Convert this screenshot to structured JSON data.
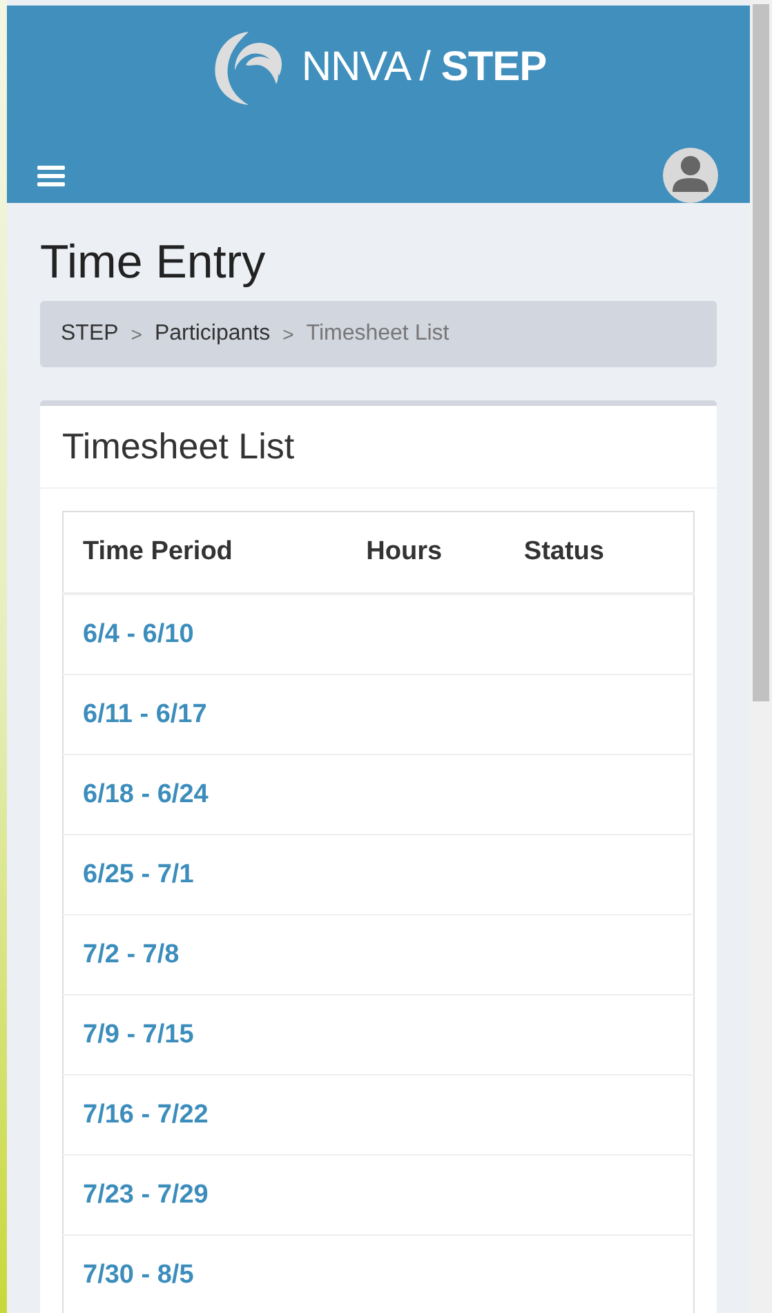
{
  "header": {
    "brand": "NNVA / ",
    "brand_bold": "STEP"
  },
  "page_title": "Time Entry",
  "breadcrumb": [
    {
      "label": "STEP",
      "current": false
    },
    {
      "separator": ">",
      "label": "Participants",
      "current": false
    },
    {
      "separator": ">",
      "label": "Timesheet List",
      "current": true
    }
  ],
  "card": {
    "title": "Timesheet List",
    "table": {
      "columns": [
        "Time Period",
        "Hours",
        "Status"
      ],
      "rows": [
        {
          "period": "6/4 - 6/10"
        },
        {
          "period": "6/11 - 6/17"
        },
        {
          "period": "6/18 - 6/24"
        },
        {
          "period": "6/25 - 7/1"
        },
        {
          "period": "7/2 - 7/8"
        },
        {
          "period": "7/9 - 7/15"
        },
        {
          "period": "7/16 - 7/22"
        },
        {
          "period": "7/23 - 7/29"
        },
        {
          "period": "7/30 - 8/5"
        }
      ]
    }
  }
}
